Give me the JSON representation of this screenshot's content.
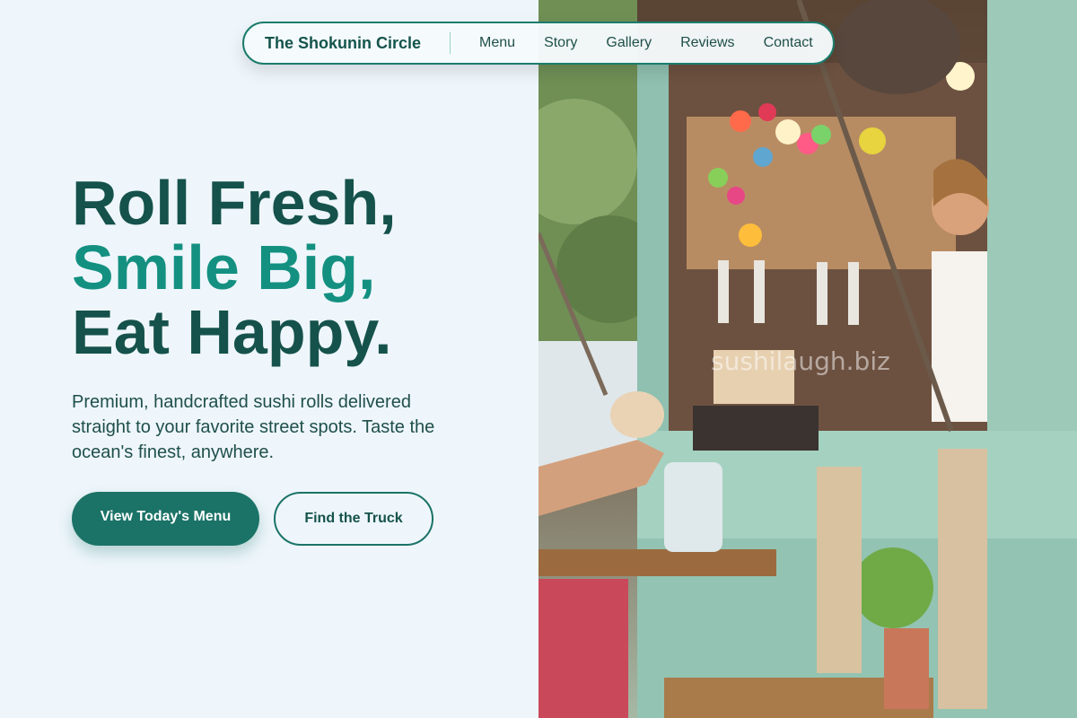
{
  "nav": {
    "brand": "The Shokunin Circle",
    "links": [
      "Menu",
      "Story",
      "Gallery",
      "Reviews",
      "Contact"
    ]
  },
  "hero": {
    "line1": "Roll Fresh,",
    "line2": "Smile Big,",
    "line3": "Eat Happy.",
    "subtitle": "Premium, handcrafted sushi rolls delivered straight to your favorite street spots. Taste the ocean's finest, anywhere.",
    "primary_cta": "View Today's Menu",
    "secondary_cta": "Find the Truck"
  },
  "photo": {
    "watermark": "sushilaugh.biz"
  },
  "colors": {
    "primary": "#1b7367",
    "accent": "#149081",
    "heading": "#15524b",
    "background": "#eef6fb"
  }
}
